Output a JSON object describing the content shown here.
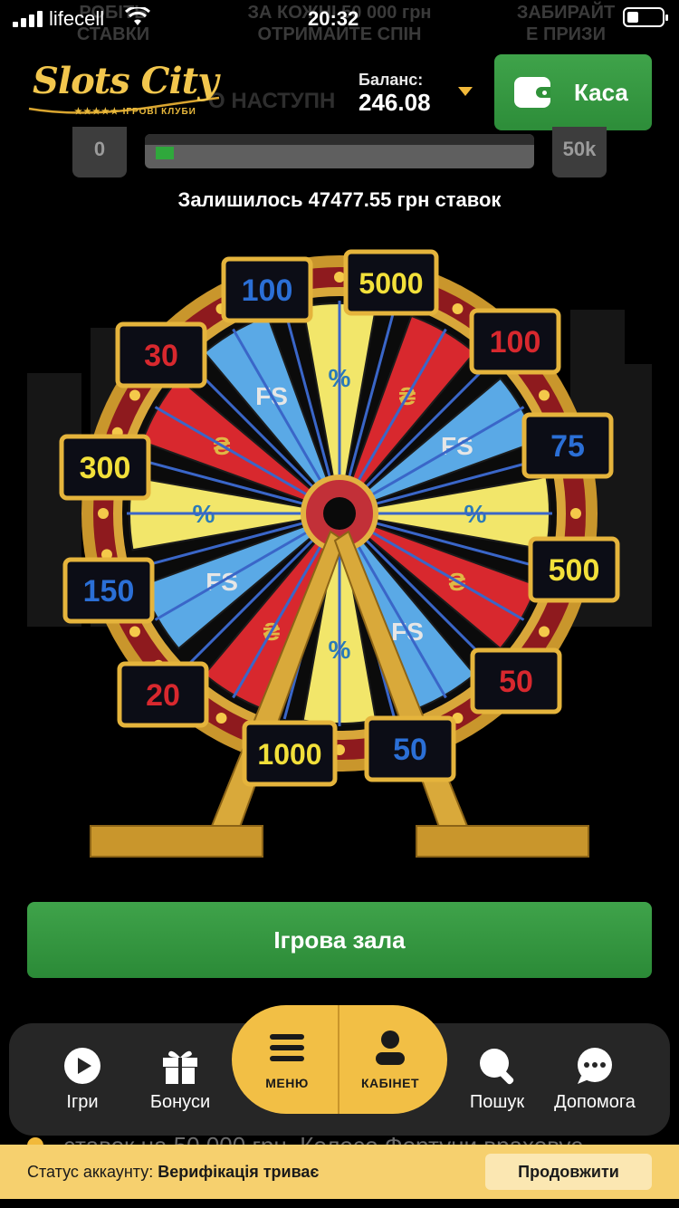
{
  "status_bar": {
    "carrier": "lifecell",
    "time": "20:32"
  },
  "ghost_banner": {
    "left": "РОБІТЬ\nСТАВКИ",
    "center": "ЗА КОЖНІ 50 000 грн\nОТРИМАЙТЕ СПІН",
    "right": "ЗАБИРАЙТ\nЕ ПРИЗИ",
    "middle": "О НАСТУПН"
  },
  "header": {
    "logo_text": "Slots City",
    "logo_sub": "★★★★★ ІГРОВІ КЛУБИ",
    "balance_label": "Баланс:",
    "balance_value": "246.08",
    "cash_button": "Каса"
  },
  "progress": {
    "min_label": "0",
    "max_label": "50k",
    "fraction": 0.05,
    "remaining_text": "Залишилось 47477.55 грн ставок"
  },
  "wheel": {
    "prizes": [
      {
        "label": "100",
        "color": "#2b6fd6"
      },
      {
        "label": "5000",
        "color": "#f2e03a"
      },
      {
        "label": "100",
        "color": "#d8282e"
      },
      {
        "label": "75",
        "color": "#2b6fd6"
      },
      {
        "label": "500",
        "color": "#f2e03a"
      },
      {
        "label": "50",
        "color": "#d8282e"
      },
      {
        "label": "50",
        "color": "#2b6fd6"
      },
      {
        "label": "1000",
        "color": "#f2e03a"
      },
      {
        "label": "20",
        "color": "#d8282e"
      },
      {
        "label": "150",
        "color": "#2b6fd6"
      },
      {
        "label": "300",
        "color": "#f2e03a"
      },
      {
        "label": "30",
        "color": "#d8282e"
      }
    ],
    "segment_symbols": [
      "%",
      "₴",
      "FS",
      "%",
      "₴",
      "FS",
      "%",
      "₴",
      "FS",
      "%",
      "₴",
      "FS"
    ]
  },
  "play_button": "Ігрова зала",
  "ticker": "ставок на 50 000 грн. Колесо Фортуни враховує",
  "nav": {
    "games": "Ігри",
    "bonuses": "Бонуси",
    "menu": "МЕНЮ",
    "cabinet": "КАБІНЕТ",
    "search": "Пошук",
    "help": "Допомога"
  },
  "account": {
    "label": "Статус аккаунту:",
    "status": "Верифікація триває",
    "continue": "Продовжити"
  },
  "colors": {
    "accent_green": "#2f9139",
    "gold": "#f2bf45",
    "status_yellow": "#f6d06e"
  }
}
